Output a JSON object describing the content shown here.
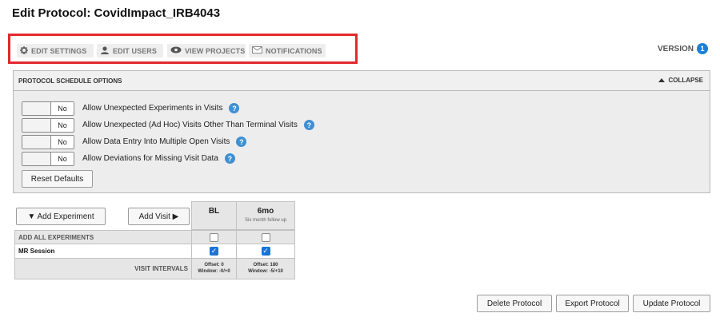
{
  "page": {
    "title": "Edit Protocol: CovidImpact_IRB4043"
  },
  "tabs": [
    {
      "icon": "gear-icon",
      "label": "EDIT SETTINGS"
    },
    {
      "icon": "user-icon",
      "label": "EDIT USERS"
    },
    {
      "icon": "eye-icon",
      "label": "VIEW PROJECTS"
    },
    {
      "icon": "envelope-icon",
      "label": "NOTIFICATIONS"
    }
  ],
  "version": {
    "label": "VERSION",
    "number": "1"
  },
  "schedule_panel": {
    "title": "PROTOCOL SCHEDULE OPTIONS",
    "collapse_label": "COLLAPSE",
    "options": [
      {
        "value": "No",
        "label": "Allow Unexpected Experiments in Visits"
      },
      {
        "value": "No",
        "label": "Allow Unexpected (Ad Hoc) Visits Other Than Terminal Visits"
      },
      {
        "value": "No",
        "label": "Allow Data Entry Into Multiple Open Visits"
      },
      {
        "value": "No",
        "label": "Allow Deviations for Missing Visit Data"
      }
    ],
    "reset_label": "Reset Defaults"
  },
  "experiments": {
    "add_experiment_label": "▼ Add Experiment",
    "add_visit_label": "Add Visit ▶",
    "visits": [
      {
        "abbr": "BL",
        "desc": "",
        "offset": "Offset: 0",
        "window": "Window: -0/+0"
      },
      {
        "abbr": "6mo",
        "desc": "Six month follow up",
        "offset": "Offset: 180",
        "window": "Window: -5/+10"
      }
    ],
    "add_all_label": "ADD ALL EXPERIMENTS",
    "add_all_checked": [
      false,
      false
    ],
    "rows": [
      {
        "label": "MR Session",
        "checked": [
          true,
          true
        ]
      }
    ],
    "visit_intervals_label": "VISIT INTERVALS"
  },
  "actions": {
    "delete_label": "Delete Protocol",
    "export_label": "Export Protocol",
    "update_label": "Update Protocol"
  },
  "colors": {
    "highlight": "#e3282f",
    "accent": "#1a7fd6"
  }
}
